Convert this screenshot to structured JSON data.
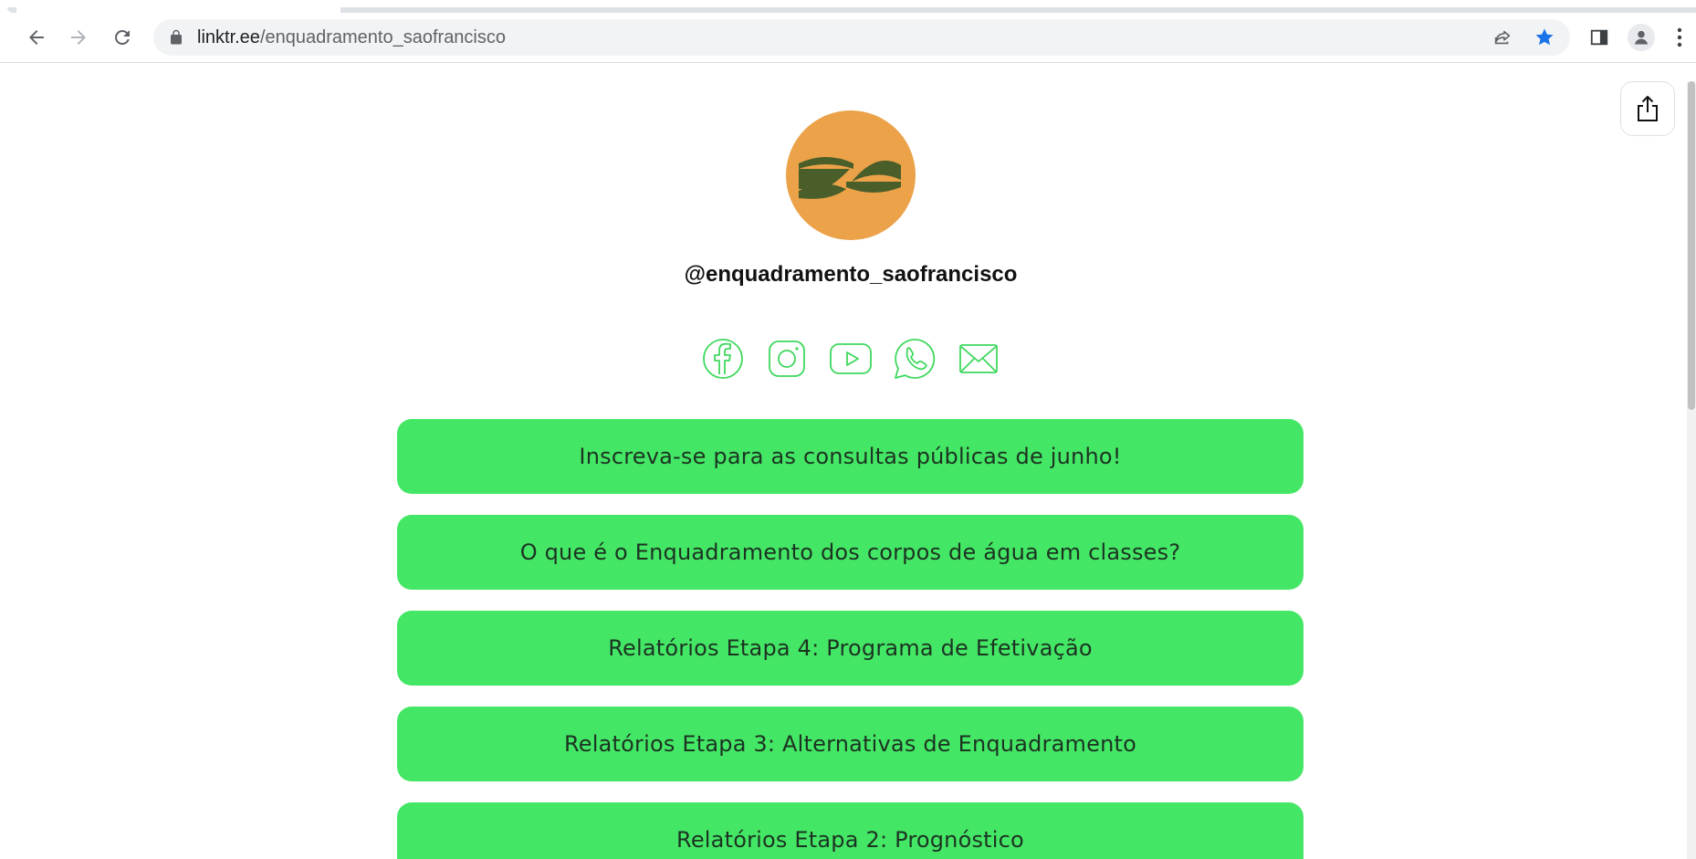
{
  "browser": {
    "url_host": "linktr.ee",
    "url_path": "/enquadramento_saofrancisco",
    "accent_color": "#1a73e8"
  },
  "profile": {
    "handle": "@enquadramento_saofrancisco",
    "avatar_bg": "#eba249",
    "avatar_fg": "#4a5e2a"
  },
  "socials": [
    {
      "icon": "facebook-icon"
    },
    {
      "icon": "instagram-icon"
    },
    {
      "icon": "youtube-icon"
    },
    {
      "icon": "whatsapp-icon"
    },
    {
      "icon": "email-icon"
    }
  ],
  "links": [
    {
      "label": "Inscreva-se para as consultas públicas de junho!"
    },
    {
      "label": "O que é o Enquadramento dos corpos de água em classes?"
    },
    {
      "label": "Relatórios Etapa 4: Programa de Efetivação"
    },
    {
      "label": "Relatórios Etapa 3: Alternativas de Enquadramento"
    },
    {
      "label": "Relatórios Etapa 2: Prognóstico"
    }
  ],
  "theme": {
    "button_bg": "#44e765",
    "button_text": "#1c3322",
    "social_color": "#3fd85e"
  }
}
